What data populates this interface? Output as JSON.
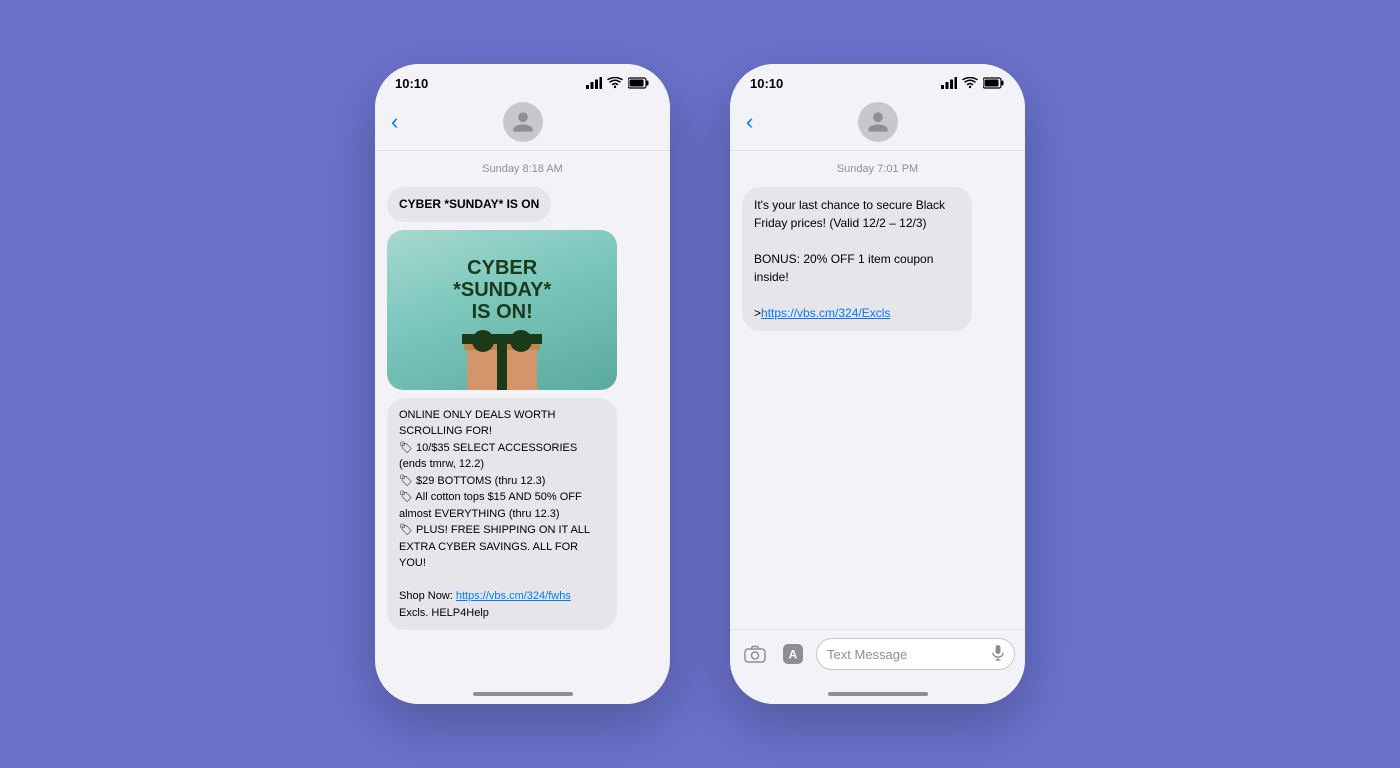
{
  "background_color": "#6B72CC",
  "phone1": {
    "status_bar": {
      "time": "10:10",
      "signal": "signal",
      "wifi": "wifi",
      "battery": "battery"
    },
    "timestamp": "Sunday 8:18 AM",
    "message_header": "CYBER *SUNDAY* IS ON",
    "mms_title_line1": "CYBER",
    "mms_title_line2": "*SUNDAY*",
    "mms_title_line3": "IS ON!",
    "bubble_body": "ONLINE ONLY DEALS WORTH SCROLLING FOR!\n🏷 10/$35 SELECT ACCESSORIES (ends tmrw, 12.2)\n🏷 $29 BOTTOMS (thru 12.3)\n🏷 All cotton tops $15 AND 50% OFF almost EVERYTHING (thru 12.3)\n🏷 PLUS! FREE SHIPPING ON IT ALL EXTRA CYBER SAVINGS. ALL FOR YOU!",
    "shop_now_label": "Shop Now:",
    "shop_now_link": "https://vbs.cm/324/fwhs",
    "excls_label": "Excls. HELP4Help"
  },
  "phone2": {
    "status_bar": {
      "time": "10:10",
      "signal": "signal",
      "wifi": "wifi",
      "battery": "battery"
    },
    "timestamp": "Sunday 7:01 PM",
    "bubble_text_line1": "It's your last chance to secure Black Friday prices! (Valid 12/2 – 12/3)",
    "bubble_text_line2": "BONUS: 20% OFF 1 item coupon inside!",
    "bubble_link_prefix": ">",
    "bubble_link": "https://vbs.cm/324/Excls",
    "input_placeholder": "Text Message"
  }
}
